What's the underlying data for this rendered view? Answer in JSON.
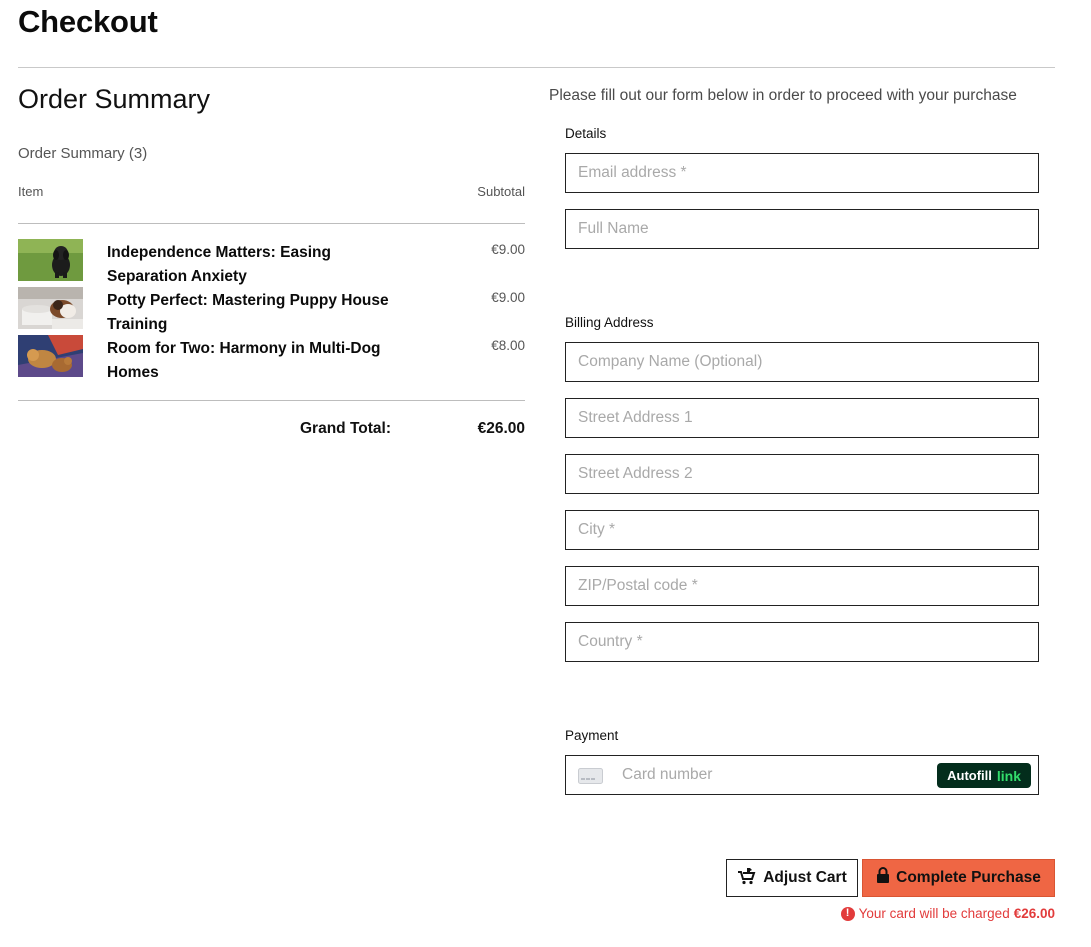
{
  "page": {
    "title": "Checkout"
  },
  "order_summary": {
    "heading": "Order Summary",
    "count_label": "Order Summary (3)",
    "columns": {
      "item": "Item",
      "subtotal": "Subtotal"
    },
    "items": [
      {
        "title": "Independence Matters: Easing Separation Anxiety",
        "price": "€9.00"
      },
      {
        "title": "Potty Perfect: Mastering Puppy House Training",
        "price": "€9.00"
      },
      {
        "title": "Room for Two: Harmony in Multi-Dog Homes",
        "price": "€8.00"
      }
    ],
    "grand_total_label": "Grand Total:",
    "grand_total_value": "€26.00"
  },
  "form": {
    "intro": "Please fill out our form below in order to proceed with your purchase",
    "details": {
      "label": "Details",
      "email_placeholder": "Email address *",
      "name_placeholder": "Full Name"
    },
    "billing": {
      "label": "Billing Address",
      "company_placeholder": "Company Name (Optional)",
      "street1_placeholder": "Street Address 1",
      "street2_placeholder": "Street Address 2",
      "city_placeholder": "City *",
      "zip_placeholder": "ZIP/Postal code *",
      "country_placeholder": "Country *"
    },
    "payment": {
      "label": "Payment",
      "card_placeholder": "Card number",
      "autofill_label": "Autofill",
      "autofill_brand": "link"
    }
  },
  "actions": {
    "adjust_cart": "Adjust Cart",
    "complete_purchase": "Complete Purchase",
    "charge_note": "Your card will be charged",
    "charge_amount": "€26.00"
  },
  "colors": {
    "accent": "#ef6644",
    "error": "#e23b3b",
    "link_brand_bg": "#032d1c",
    "link_brand_text": "#33dd6b"
  },
  "icons": [
    "dog-cart-icon",
    "lock-icon",
    "alert-icon",
    "credit-card-icon"
  ]
}
